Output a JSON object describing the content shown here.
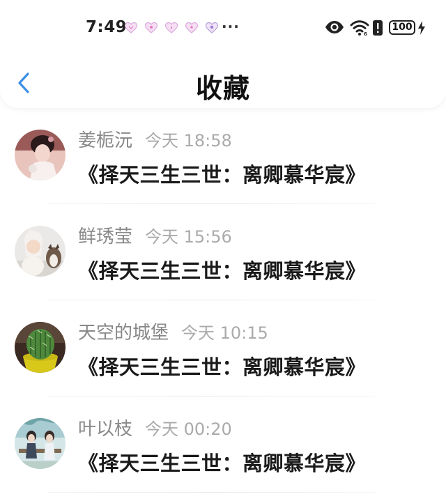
{
  "status_bar": {
    "time": "7:49",
    "more_dots": "···",
    "battery": "100"
  },
  "nav": {
    "title": "收藏"
  },
  "favorites": [
    {
      "name": "姜栀沅",
      "time": "今天 18:58",
      "title": "《择天三生三世：离卿慕华宸》"
    },
    {
      "name": "鲜琇莹",
      "time": "今天 15:56",
      "title": "《择天三生三世：离卿慕华宸》"
    },
    {
      "name": "天空的城堡",
      "time": "今天 10:15",
      "title": "《择天三生三世：离卿慕华宸》"
    },
    {
      "name": "叶以枝",
      "time": "今天 00:20",
      "title": "《择天三生三世：离卿慕华宸》"
    }
  ],
  "colors": {
    "accent": "#3a8fe6",
    "name_text": "#888888",
    "time_text": "#aaaaaa",
    "title_text": "#1a1a1a"
  },
  "icons": [
    "heart-icon",
    "eye-icon",
    "wifi-icon",
    "alert-icon",
    "battery-icon",
    "charging-icon",
    "back-arrow-icon"
  ]
}
